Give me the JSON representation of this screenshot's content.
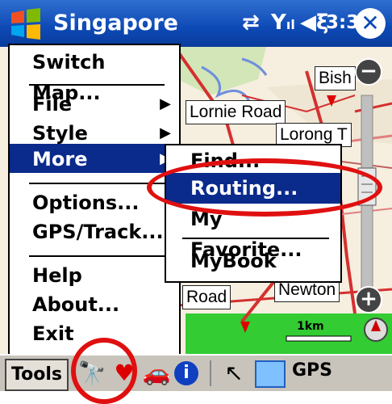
{
  "window": {
    "title": "Singapore",
    "time": "3:37",
    "close_glyph": "✕"
  },
  "map": {
    "labels": [
      "Bish",
      "Lornie Road",
      "Lorong T",
      "Road",
      "Newton",
      "Bish"
    ],
    "scale_label": "1km"
  },
  "tools_menu": {
    "items": [
      {
        "label": "Switch Map..."
      },
      {
        "label": "File"
      },
      {
        "label": "Style"
      },
      {
        "label": "More"
      },
      {
        "label": "Options..."
      },
      {
        "label": "GPS/Track..."
      },
      {
        "label": "Help"
      },
      {
        "label": "About..."
      },
      {
        "label": "Exit"
      }
    ]
  },
  "more_menu": {
    "items": [
      {
        "label": "Find..."
      },
      {
        "label": "Routing..."
      },
      {
        "label": "My Favorite..."
      },
      {
        "label": "MyBook"
      }
    ]
  },
  "bottom_bar": {
    "tools_label": "Tools",
    "gps_label": "GPS"
  },
  "colors": {
    "titlebar": "#0d49b5",
    "selected": "#0a2a8c",
    "highlight_ring": "#e01010"
  },
  "icons": [
    "windows-start-icon",
    "connectivity-icon",
    "signal-icon",
    "volume-icon",
    "binoculars-icon",
    "heart-icon",
    "vehicle-icon",
    "info-icon",
    "cursor-icon",
    "map-view-icon",
    "zoom-out-icon",
    "zoom-in-icon",
    "compass-icon"
  ]
}
